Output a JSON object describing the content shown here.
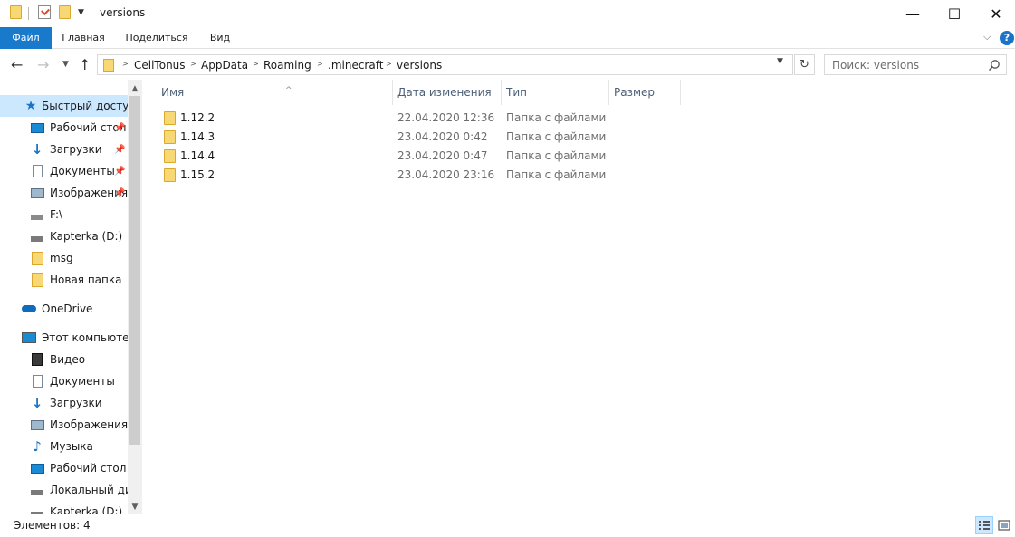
{
  "window": {
    "title": "versions",
    "minimize_glyph": "—",
    "maximize_glyph": "☐",
    "close_glyph": "✕"
  },
  "ribbon": {
    "tabs": [
      {
        "label": "Файл",
        "active": true
      },
      {
        "label": "Главная"
      },
      {
        "label": "Поделиться"
      },
      {
        "label": "Вид"
      }
    ],
    "help_label": "?"
  },
  "address": {
    "breadcrumbs": [
      "CellTonus",
      "AppData",
      "Roaming",
      ".minecraft",
      "versions"
    ]
  },
  "search": {
    "placeholder": "Поиск: versions"
  },
  "navpane": {
    "items": [
      {
        "label": "Быстрый доступ",
        "icon": "star-icon",
        "pinned": false
      },
      {
        "label": "Рабочий стол",
        "icon": "desktop-icon",
        "pinned": true
      },
      {
        "label": "Загрузки",
        "icon": "downloads-icon",
        "pinned": true
      },
      {
        "label": "Документы",
        "icon": "documents-icon",
        "pinned": true
      },
      {
        "label": "Изображения",
        "icon": "pictures-icon",
        "pinned": true
      },
      {
        "label": "F:\\",
        "icon": "drive-unknown-icon",
        "pinned": false
      },
      {
        "label": "Kapterka (D:)",
        "icon": "drive-icon",
        "pinned": false
      },
      {
        "label": "msg",
        "icon": "folder-icon",
        "pinned": false
      },
      {
        "label": "Новая папка",
        "icon": "folder-icon",
        "pinned": false
      },
      {
        "label": "OneDrive",
        "icon": "onedrive-icon",
        "pinned": false
      },
      {
        "label": "Этот компьютер",
        "icon": "computer-icon",
        "pinned": false
      },
      {
        "label": "Видео",
        "icon": "video-icon",
        "pinned": false
      },
      {
        "label": "Документы",
        "icon": "documents-icon",
        "pinned": false
      },
      {
        "label": "Загрузки",
        "icon": "downloads-icon",
        "pinned": false
      },
      {
        "label": "Изображения",
        "icon": "pictures-icon",
        "pinned": false
      },
      {
        "label": "Музыка",
        "icon": "music-icon",
        "pinned": false
      },
      {
        "label": "Рабочий стол",
        "icon": "desktop-icon",
        "pinned": false
      },
      {
        "label": "Локальный диск",
        "icon": "local-disk-icon",
        "pinned": false
      },
      {
        "label": "Kapterka (D:)",
        "icon": "drive-icon",
        "pinned": false
      }
    ]
  },
  "files": {
    "columns": [
      "Имя",
      "Дата изменения",
      "Тип",
      "Размер"
    ],
    "rows": [
      {
        "name": "1.12.2",
        "date": "22.04.2020 12:36",
        "type": "Папка с файлами"
      },
      {
        "name": "1.14.3",
        "date": "23.04.2020 0:42",
        "type": "Папка с файлами"
      },
      {
        "name": "1.14.4",
        "date": "23.04.2020 0:47",
        "type": "Папка с файлами"
      },
      {
        "name": "1.15.2",
        "date": "23.04.2020 23:16",
        "type": "Папка с файлами"
      }
    ]
  },
  "status": {
    "text": "Элементов: 4"
  },
  "colors": {
    "accent": "#1979ca",
    "selection": "#cce8ff",
    "folder": "#f8d775"
  }
}
